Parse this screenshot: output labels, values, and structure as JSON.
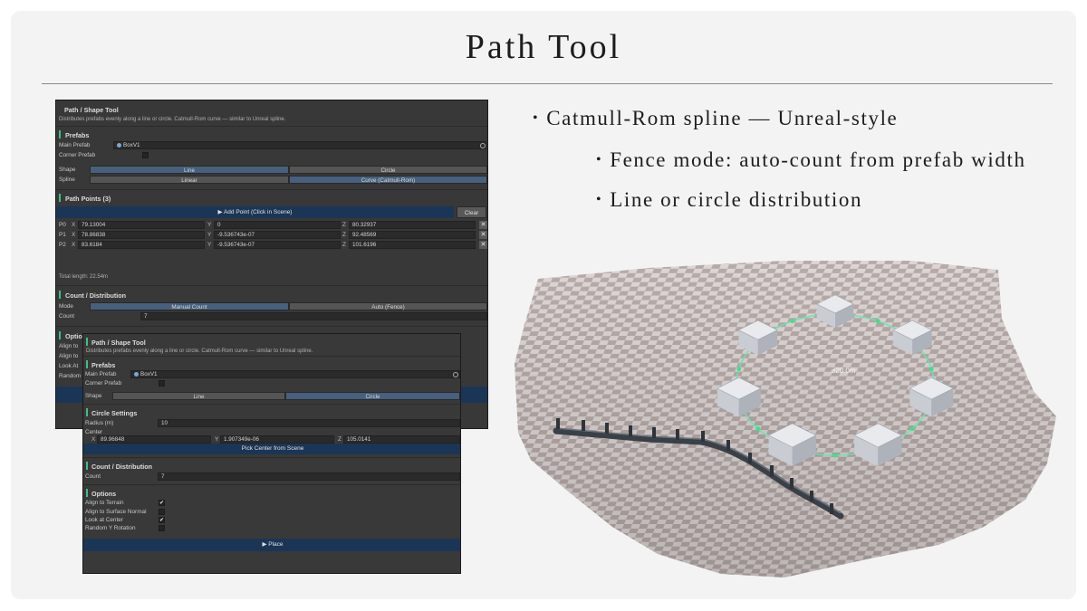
{
  "slide": {
    "title": "Path Tool",
    "bullets": [
      "Catmull-Rom spline — Unreal-style",
      "Fence mode: auto-count from prefab width",
      "Line or circle distribution"
    ]
  },
  "panel_a": {
    "title": "Path / Shape Tool",
    "description": "Distributes prefabs evenly along a line or circle. Catmull-Rom curve — similar to Unreal spline.",
    "prefabs_header": "Prefabs",
    "main_prefab_label": "Main Prefab",
    "main_prefab_value": "BoxV1",
    "corner_prefab_label": "Corner Prefab",
    "shape_label": "Shape",
    "shape_options": [
      "Line",
      "Circle"
    ],
    "spline_label": "Spline",
    "spline_options": [
      "Linear",
      "Curve (Catmull-Rom)"
    ],
    "path_points_header": "Path Points (3)",
    "add_point_button": "▶ Add Point (Click in Scene)",
    "clear_button": "Clear",
    "points": [
      {
        "label": "P0",
        "x": "79.13004",
        "y": "0",
        "z": "80.32937"
      },
      {
        "label": "P1",
        "x": "78.86838",
        "y": "-9.536743e-07",
        "z": "92.48569"
      },
      {
        "label": "P2",
        "x": "83.6184",
        "y": "-9.536743e-07",
        "z": "101.6196"
      }
    ],
    "axis_x": "X",
    "axis_y": "Y",
    "axis_z": "Z",
    "remove_label": "✕",
    "total_length": "Total length: 22.54m",
    "count_header": "Count / Distribution",
    "mode_label": "Mode",
    "mode_options": [
      "Manual Count",
      "Auto (Fence)"
    ],
    "count_label": "Count",
    "count_value": "7",
    "options_header": "Options",
    "options_partial": [
      "Align to",
      "Align to",
      "Look At",
      "Random"
    ]
  },
  "panel_b": {
    "title": "Path / Shape Tool",
    "description": "Distributes prefabs evenly along a line or circle. Catmull-Rom curve — similar to Unreal spline.",
    "prefabs_header": "Prefabs",
    "main_prefab_label": "Main Prefab",
    "main_prefab_value": "BoxV1",
    "corner_prefab_label": "Corner Prefab",
    "shape_label": "Shape",
    "shape_options": [
      "Line",
      "Circle"
    ],
    "circle_header": "Circle Settings",
    "radius_label": "Radius (m)",
    "radius_value": "10",
    "center_label": "Center",
    "center_x": "89.96848",
    "center_y": "1.907349e-06",
    "center_z": "105.0141",
    "pick_center_button": "Pick Center from Scene",
    "count_header": "Count / Distribution",
    "count_label": "Count",
    "count_value": "7",
    "options_header": "Options",
    "options": [
      {
        "label": "Align to Terrain",
        "checked": true
      },
      {
        "label": "Align to Surface Normal",
        "checked": false
      },
      {
        "label": "Look at Center",
        "checked": true
      },
      {
        "label": "Random Y Rotation",
        "checked": false
      }
    ],
    "check_mark": "✔",
    "place_button": "▶ Place"
  },
  "scene": {
    "radius_label": "⌀20.0m",
    "box_count": 7,
    "ground_color": "#b6aaa8",
    "accent_color": "#3fe08a"
  }
}
